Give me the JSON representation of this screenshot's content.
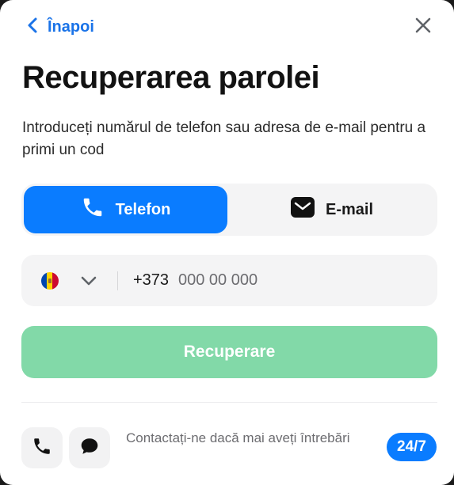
{
  "nav": {
    "back_label": "Înapoi"
  },
  "page": {
    "title": "Recuperarea parolei",
    "subtitle": "Introduceți numărul de telefon sau adresa de e-mail pentru a primi un cod"
  },
  "method_toggle": {
    "selected": "phone",
    "phone_label": "Telefon",
    "email_label": "E-mail"
  },
  "phone_field": {
    "country": "Moldova",
    "prefix": "+373",
    "placeholder": "000 00 000"
  },
  "submit": {
    "label": "Recuperare",
    "enabled": false
  },
  "support": {
    "text": "Contactați-ne dacă mai aveți întrebări",
    "badge": "24/7"
  },
  "colors": {
    "accent": "#0a7cff",
    "link": "#1a73e8",
    "submit_disabled": "#82d9a8",
    "field_bg": "#f4f4f5"
  },
  "icons": [
    "chevron-left-icon",
    "close-icon",
    "phone-icon",
    "mail-icon",
    "moldova-flag-icon",
    "chevron-down-icon",
    "chat-bubble-icon"
  ]
}
